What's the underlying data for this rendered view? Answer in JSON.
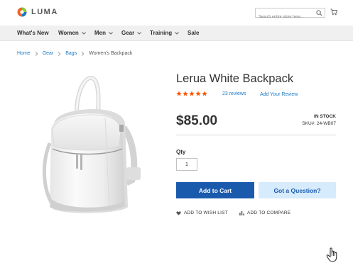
{
  "header": {
    "logo_text": "LUMA",
    "search_placeholder": "Search entire store here...",
    "colors": {
      "logo_orange": "#f26322",
      "logo_green": "#8dc63f",
      "logo_blue": "#1979c3"
    }
  },
  "nav": {
    "items": [
      {
        "label": "What's New",
        "has_dropdown": false
      },
      {
        "label": "Women",
        "has_dropdown": true
      },
      {
        "label": "Men",
        "has_dropdown": true
      },
      {
        "label": "Gear",
        "has_dropdown": true
      },
      {
        "label": "Training",
        "has_dropdown": true
      },
      {
        "label": "Sale",
        "has_dropdown": false
      }
    ]
  },
  "breadcrumb": {
    "items": [
      "Home",
      "Gear",
      "Bags"
    ],
    "current": "Women's Backpack"
  },
  "product": {
    "title": "Lerua White Backpack",
    "rating_stars": 5,
    "reviews_text": "23 reviews",
    "add_review_text": "Add Your Review",
    "price": "$85.00",
    "stock": "IN STOCK",
    "sku_label": "SKU#:",
    "sku_value": "24-WB07",
    "qty_label": "Qty",
    "qty_value": "1",
    "add_to_cart_label": "Add to Cart",
    "question_label": "Got a Question?",
    "wishlist_label": "ADD TO WISH LIST",
    "compare_label": "ADD TO COMPARE",
    "colors": {
      "star": "#ff5501",
      "link": "#1979c3",
      "primary_button": "#1a5aad",
      "secondary_button": "#d6ebfb"
    }
  },
  "icons": [
    "search-icon",
    "cart-icon",
    "chevron-down-icon",
    "chevron-right-icon",
    "star-icon",
    "heart-icon",
    "compare-icon",
    "hand-cursor-icon"
  ]
}
